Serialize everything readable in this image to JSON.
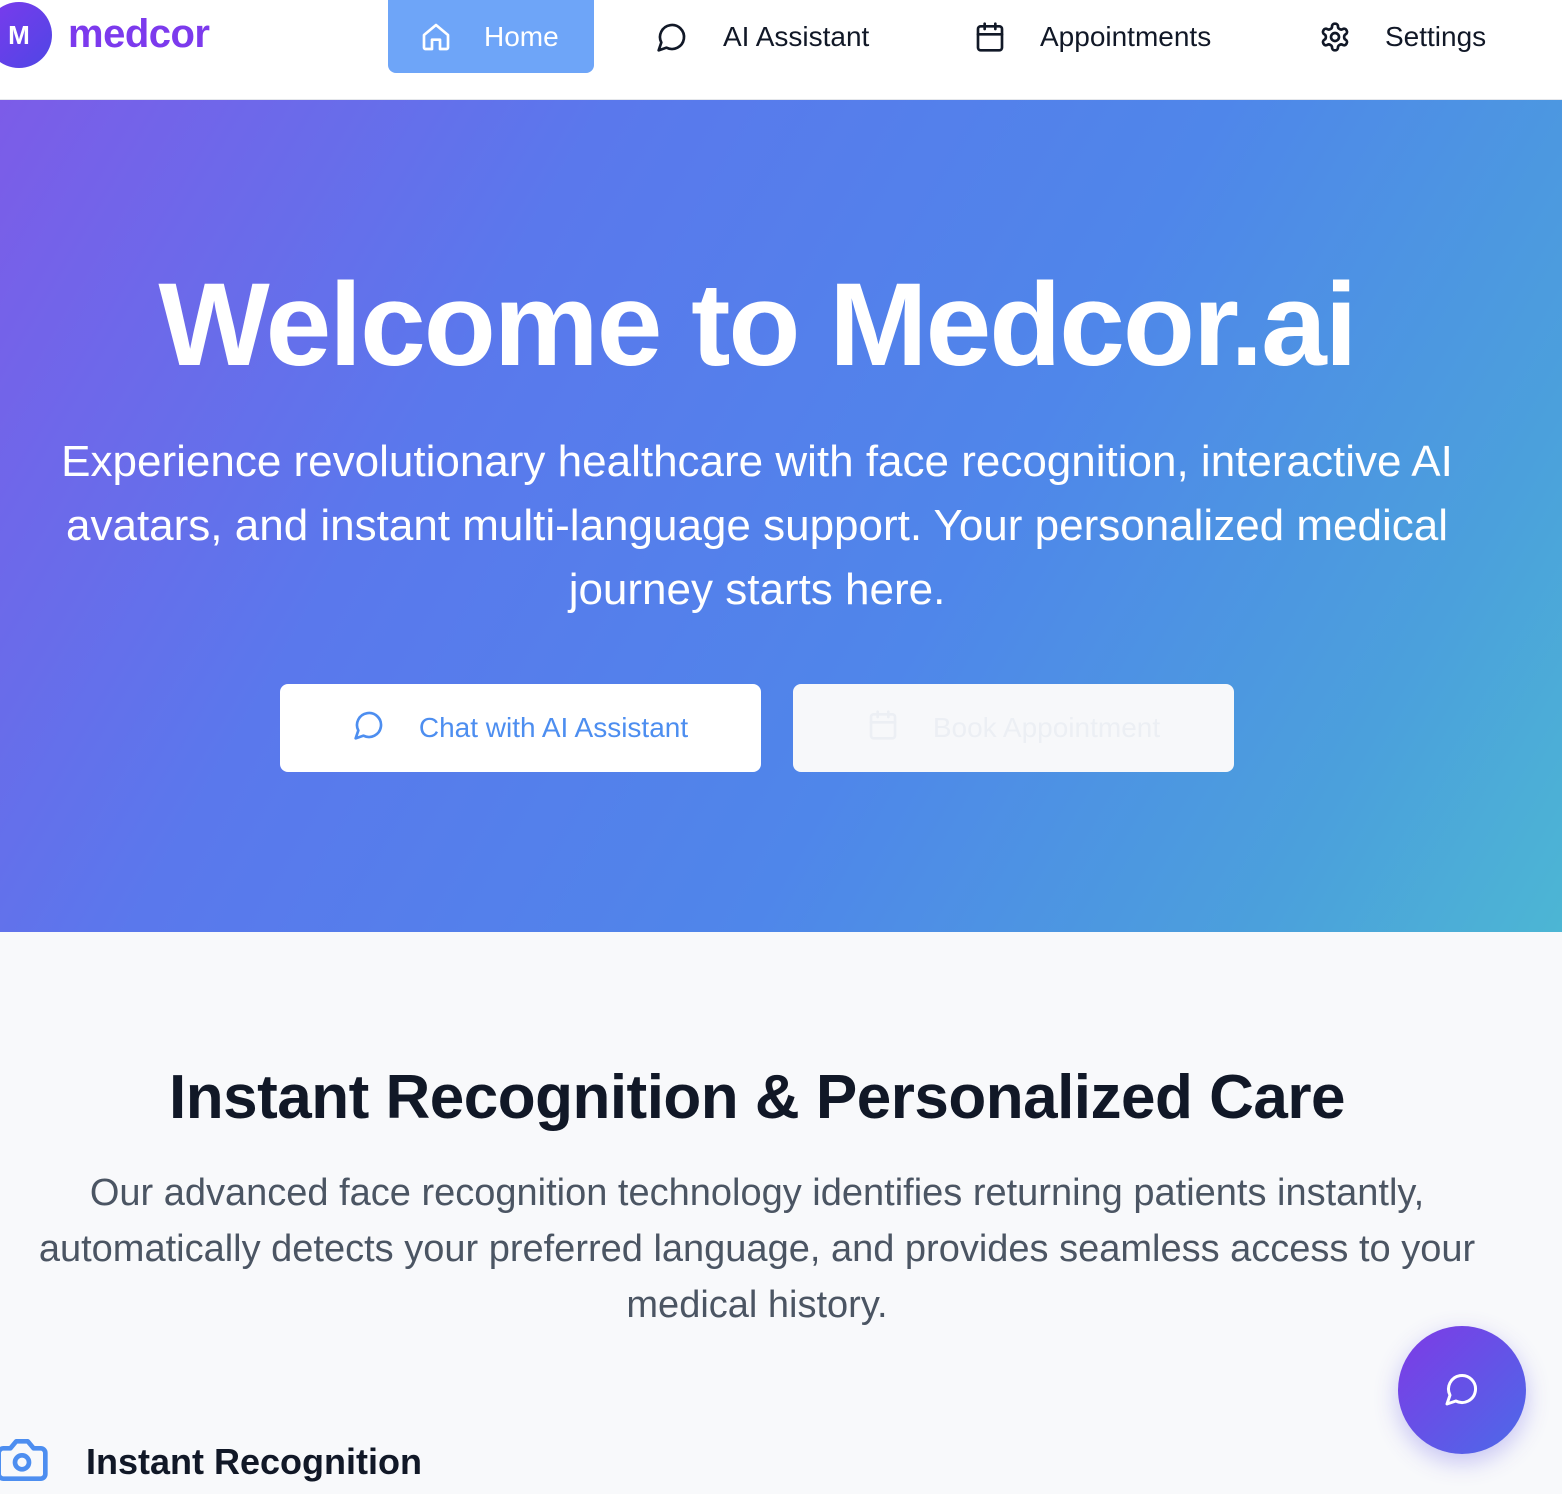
{
  "brand": {
    "initial": "M",
    "name": "medcor"
  },
  "nav": {
    "items": [
      {
        "label": "Home",
        "icon": "home-icon",
        "active": true
      },
      {
        "label": "AI Assistant",
        "icon": "chat-bubble-icon",
        "active": false
      },
      {
        "label": "Appointments",
        "icon": "calendar-icon",
        "active": false
      },
      {
        "label": "Settings",
        "icon": "gear-icon",
        "active": false
      }
    ]
  },
  "hero": {
    "title": "Welcome to Medcor.ai",
    "subtitle": "Experience revolutionary healthcare with face recognition, interactive AI avatars, and instant multi-language support. Your personalized medical journey starts here.",
    "primary_button": {
      "label": "Chat with AI Assistant",
      "icon": "chat-bubble-icon"
    },
    "secondary_button": {
      "label": "Book Appointment",
      "icon": "calendar-icon"
    }
  },
  "features_section": {
    "title": "Instant Recognition & Personalized Care",
    "description": "Our advanced face recognition technology identifies returning patients instantly, automatically detects your preferred language, and provides seamless access to your medical history.",
    "items": [
      {
        "title": "Instant Recognition",
        "icon": "camera-icon"
      }
    ]
  },
  "fab": {
    "icon": "chat-bubble-icon"
  },
  "colors": {
    "brand": "#7c3aed",
    "nav_active": "#6ea5f8",
    "hero_gradient_start": "#7c5ce8",
    "hero_gradient_end": "#4cb6d4",
    "primary_button_text": "#4d8ef0"
  }
}
